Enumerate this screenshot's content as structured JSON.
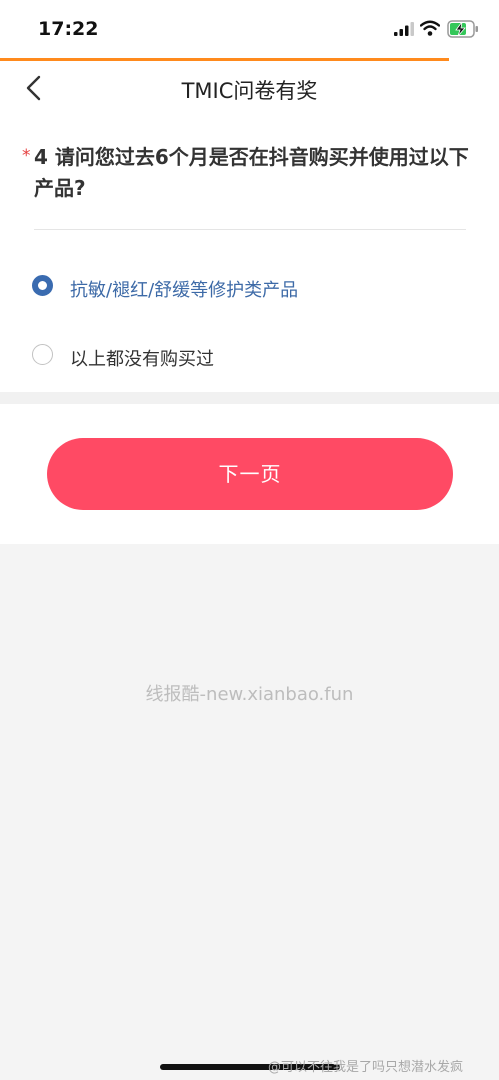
{
  "status_bar": {
    "time": "17:22"
  },
  "nav": {
    "title": "TMIC问卷有奖"
  },
  "question": {
    "required_mark": "*",
    "text": "4 请问您过去6个月是否在抖音购买并使用过以下产品?"
  },
  "options": [
    {
      "label": "抗敏/褪红/舒缓等修护类产品",
      "selected": true
    },
    {
      "label": "以上都没有购买过",
      "selected": false
    }
  ],
  "next_button": {
    "label": "下一页"
  },
  "watermark": "线报酷-new.xianbao.fun",
  "credit": "@可以不往我是了吗只想潜水发疯",
  "colors": {
    "accent": "#ff8a1d",
    "primary_button": "#ff4a64",
    "selected": "#3a6bb0"
  }
}
